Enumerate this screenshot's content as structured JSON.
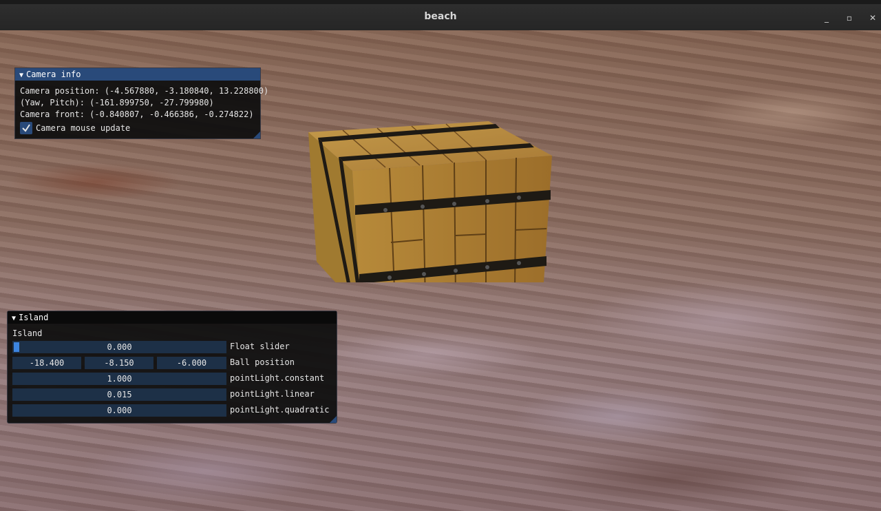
{
  "window": {
    "title": "beach",
    "minimize": "_",
    "maximize": "▫",
    "close": "✕"
  },
  "camera_info": {
    "title": "Camera info",
    "position": "Camera position: (-4.567880, -3.180840, 13.228800)",
    "yaw_pitch": "(Yaw, Pitch): (-161.899750, -27.799980)",
    "front": "Camera front: (-0.840807, -0.466386, -0.274822)",
    "mouse_update_label": "Camera mouse update",
    "mouse_update_checked": true
  },
  "island": {
    "title": "Island",
    "heading": "Island",
    "float_slider": {
      "value": "0.000",
      "label": "Float slider"
    },
    "ball_position": {
      "x": "-18.400",
      "y": "-8.150",
      "z": "-6.000",
      "label": "Ball position"
    },
    "constant": {
      "value": "1.000",
      "label": "pointLight.constant"
    },
    "linear": {
      "value": "0.015",
      "label": "pointLight.linear"
    },
    "quadratic": {
      "value": "0.000",
      "label": "pointLight.quadratic"
    }
  },
  "colors": {
    "accent": "#294a7a",
    "frame_bg": "#1d3047",
    "slider_grab": "#3d85e0"
  }
}
